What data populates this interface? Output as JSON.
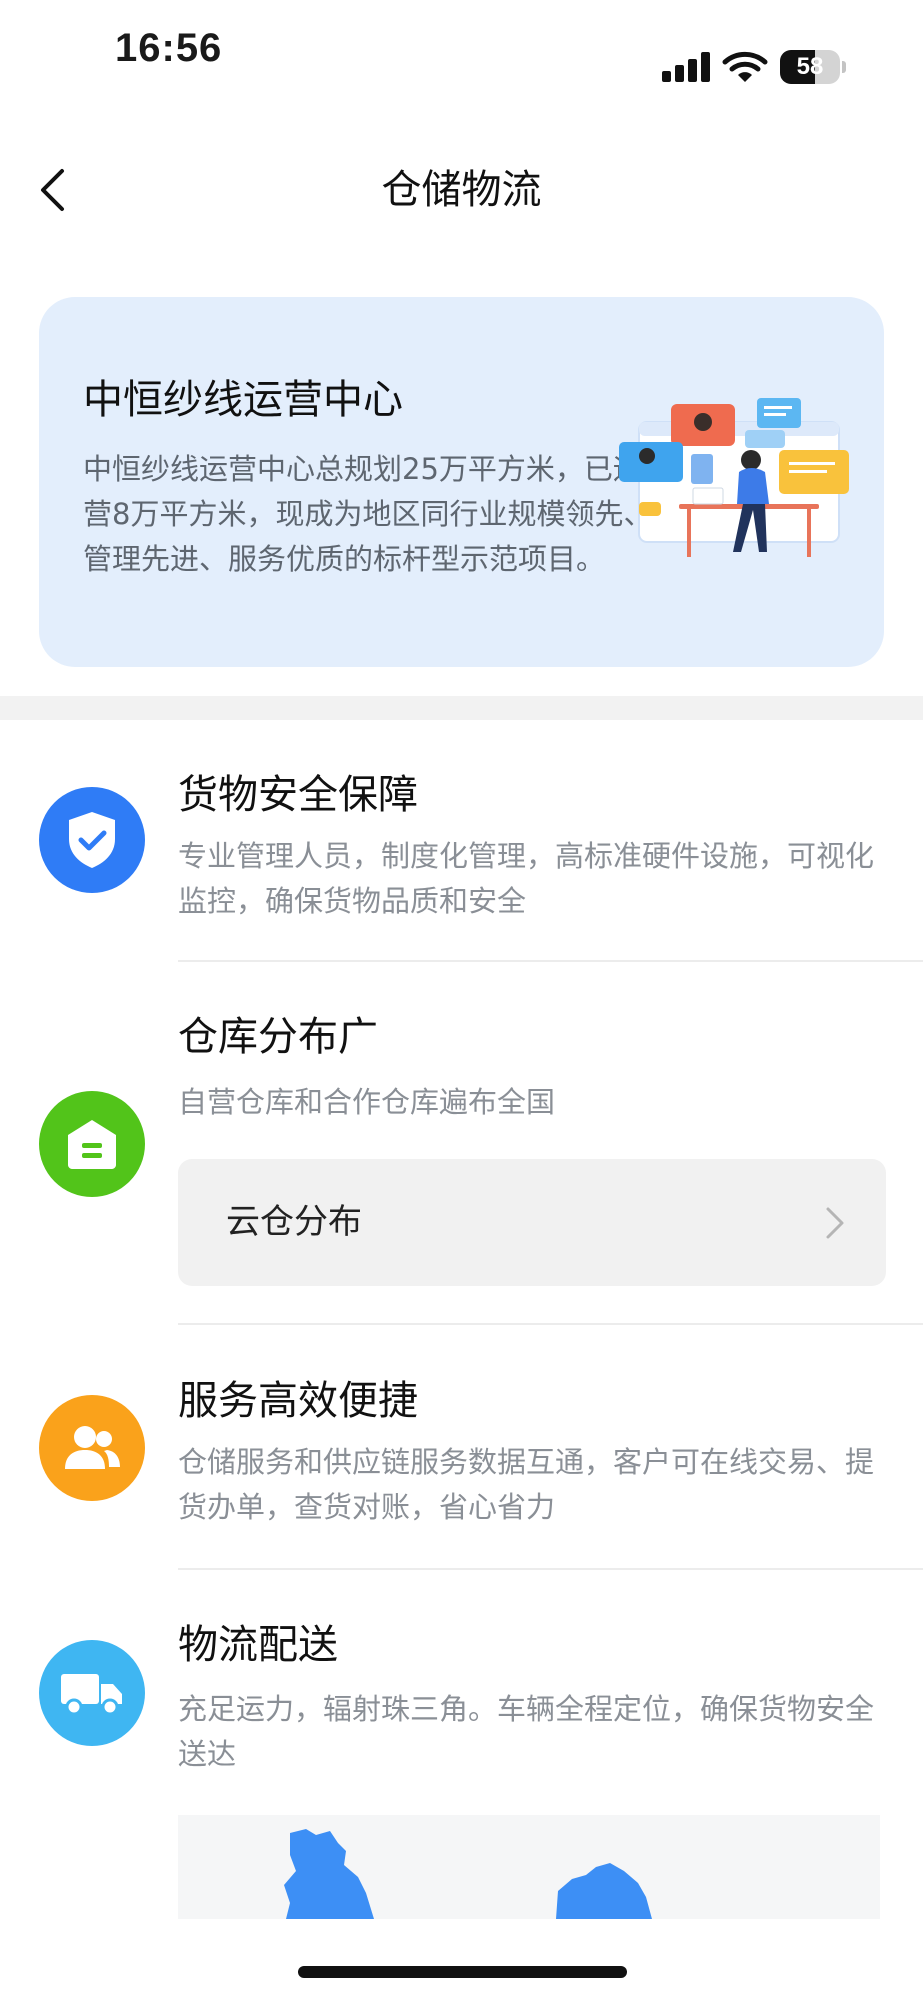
{
  "status_bar": {
    "time": "16:56",
    "battery_level": "58",
    "battery_fraction": 0.58
  },
  "nav": {
    "title": "仓储物流"
  },
  "hero": {
    "title": "中恒纱线运营中心",
    "description": "中恒纱线运营中心总规划25万平方米，已运营8万平方米，现成为地区同行业规模领先、管理先进、服务优质的标杆型示范项目。"
  },
  "features": [
    {
      "title": "货物安全保障",
      "description": "专业管理人员，制度化管理，高标准硬件设施，可视化监控，确保货物品质和安全",
      "icon": "shield-check-icon",
      "color": "#2f7cf6"
    },
    {
      "title": "仓库分布广",
      "description": "自营仓库和合作仓库遍布全国",
      "icon": "warehouse-icon",
      "color": "#52c41a",
      "action_label": "云仓分布"
    },
    {
      "title": "服务高效便捷",
      "description": "仓储服务和供应链服务数据互通，客户可在线交易、提货办单，查货对账，省心省力",
      "icon": "users-icon",
      "color": "#faa21b"
    },
    {
      "title": "物流配送",
      "description": "充足运力，辐射珠三角。车辆全程定位，确保货物安全送达",
      "icon": "truck-icon",
      "color": "#3fb6f2"
    }
  ],
  "colors": {
    "hero_bg": "#e3eefc",
    "map_blue": "#3d8ff5",
    "section_gap": "#f2f2f2"
  }
}
